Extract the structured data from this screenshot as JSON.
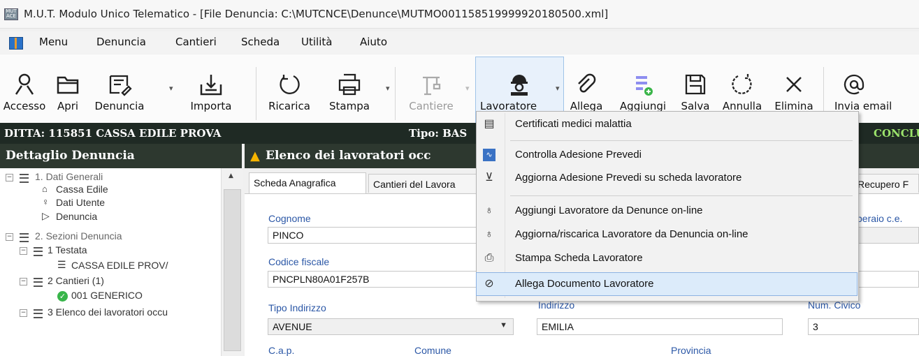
{
  "window": {
    "title": "M.U.T. Modulo Unico Telematico - [File Denuncia: C:\\MUTCNCE\\Denunce\\MUTMO001158519999920180500.xml]"
  },
  "menubar": {
    "items": [
      "Menu",
      "Denuncia",
      "Cantieri",
      "Scheda",
      "Utilità",
      "Aiuto"
    ]
  },
  "toolbar": {
    "accesso": "Accesso",
    "apri": "Apri",
    "denuncia": "Denuncia",
    "importa": "Importa",
    "ricarica": "Ricarica",
    "stampa": "Stampa",
    "cantiere": "Cantiere",
    "lavoratore": "Lavoratore",
    "allega": "Allega",
    "aggiungi": "Aggiungi",
    "salva": "Salva",
    "annulla": "Annulla",
    "elimina": "Elimina",
    "invia": "Invia email"
  },
  "company_bar": {
    "ditta": "DITTA: 115851 CASSA EDILE  PROVA",
    "tipo": "Tipo: BAS",
    "stato": "CONCLUS"
  },
  "left_panel": {
    "title": "Dettaglio Denuncia",
    "tree": {
      "dati_generali": "1. Dati Generali",
      "cassa_edile": "Cassa Edile",
      "dati_utente": "Dati Utente",
      "denuncia": "Denuncia",
      "sezioni": "2. Sezioni Denuncia",
      "testata": "1 Testata",
      "testata_child": "CASSA EDILE  PROV/",
      "cantieri": "2 Cantieri (1)",
      "generico": "001 GENERICO",
      "elenco": "3 Elenco dei lavoratori occu"
    }
  },
  "right_panel": {
    "title": "Elenco dei lavoratori occ",
    "tabs": {
      "anagrafica": "Scheda Anagrafica",
      "cantieri": "Cantieri del Lavora",
      "recupero": "Recupero F"
    },
    "form": {
      "cognome_label": "Cognome",
      "cognome_value": "PINCO",
      "codfis_label": "Codice fiscale",
      "codfis_value": "PNCPLN80A01F257B",
      "tipo_indirizzo_label": "Tipo Indirizzo",
      "tipo_indirizzo_value": "AVENUE",
      "indirizzo_label": "Indirizzo",
      "indirizzo_value": "EMILIA",
      "civico_label": "Num. Civico",
      "civico_value": "3",
      "cap_label": "C.a.p.",
      "comune_label": "Comune",
      "provincia_label": "Provincia",
      "operaio_label": "peraio c.e."
    }
  },
  "lavoratore_menu": {
    "items": [
      {
        "label": "Certificati medici malattia",
        "icon": "medical-certificate-icon"
      },
      {
        "label": "Controlla Adesione Prevedi",
        "icon": "chart-check-icon"
      },
      {
        "label": "Aggiorna Adesione Prevedi su scheda lavoratore",
        "icon": "update-icon"
      },
      {
        "label": "Aggiungi Lavoratore da Denunce on-line",
        "icon": "add-person-icon"
      },
      {
        "label": "Aggiorna/riscarica Lavoratore da Denuncia on-line",
        "icon": "refresh-person-icon"
      },
      {
        "label": "Stampa Scheda Lavoratore",
        "icon": "printer-icon"
      },
      {
        "label": "Allega Documento Lavoratore",
        "icon": "paperclip-icon"
      }
    ]
  },
  "colors": {
    "dark_header": "#2d382f",
    "accent_green": "#9be36b",
    "label_blue": "#2b57a6",
    "highlight": "#dcebfa"
  }
}
